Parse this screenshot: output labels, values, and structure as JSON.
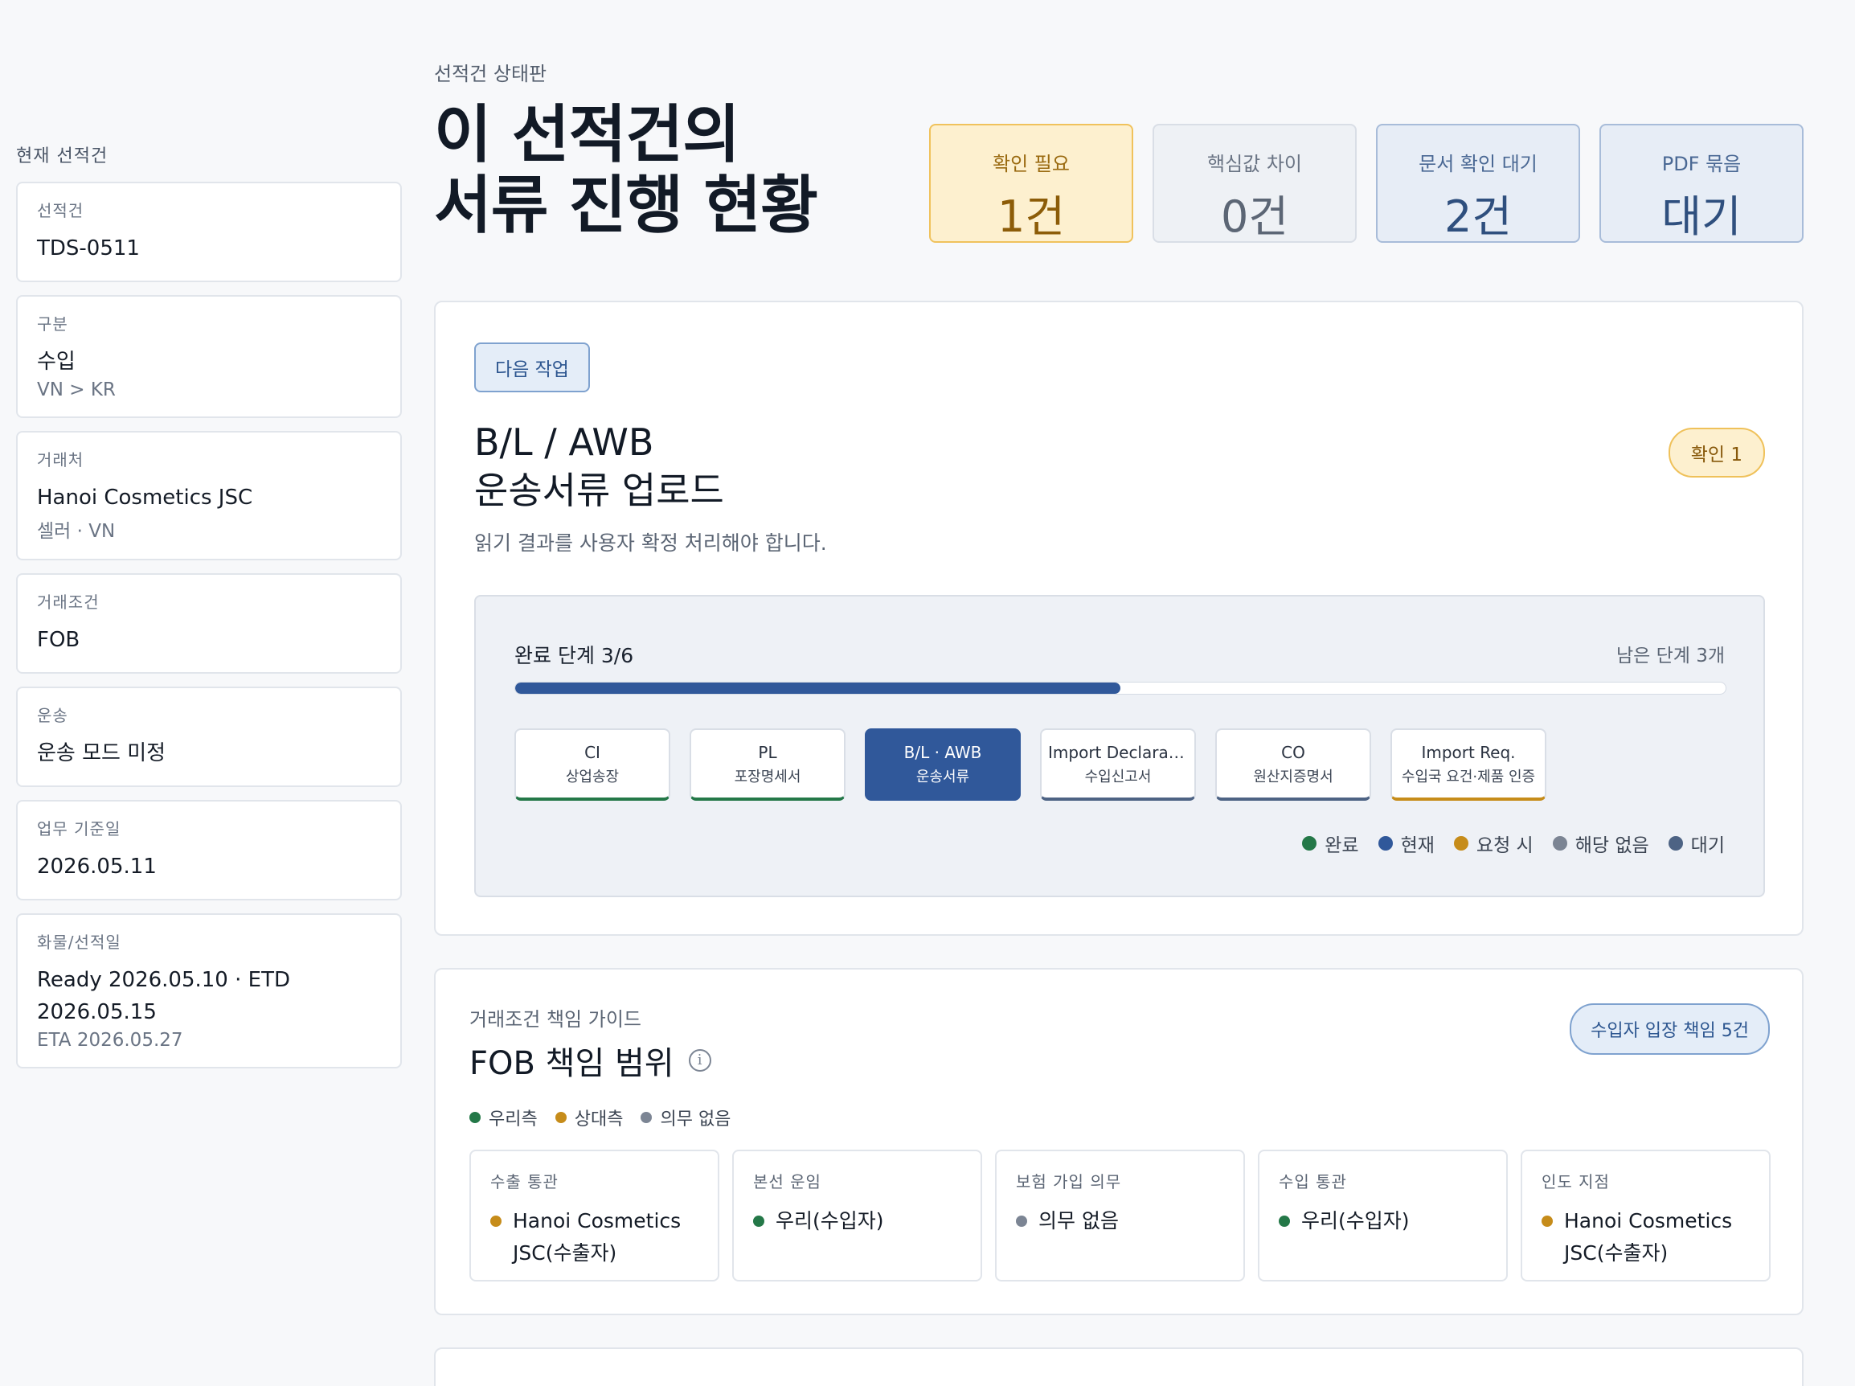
{
  "sidebar": {
    "heading": "현재 선적건",
    "cards": [
      {
        "label": "선적건",
        "value": "TDS-0511",
        "sub": ""
      },
      {
        "label": "구분",
        "value": "수입",
        "sub": "VN > KR"
      },
      {
        "label": "거래처",
        "value": "Hanoi Cosmetics JSC",
        "sub": "셀러 · VN"
      },
      {
        "label": "거래조건",
        "value": "FOB",
        "sub": ""
      },
      {
        "label": "운송",
        "value": "운송 모드 미정",
        "sub": ""
      },
      {
        "label": "업무 기준일",
        "value": "2026.05.11",
        "sub": ""
      },
      {
        "label": "화물/선적일",
        "value": "Ready 2026.05.10 · ETD 2026.05.15",
        "sub": "ETA 2026.05.27"
      }
    ]
  },
  "header": {
    "crumb": "선적건 상태판",
    "title_line1": "이 선적건의",
    "title_line2": "서류 진행 현황"
  },
  "stats": [
    {
      "label": "확인 필요",
      "value": "1건",
      "tone": "warn"
    },
    {
      "label": "핵심값 차이",
      "value": "0건",
      "tone": "neutral"
    },
    {
      "label": "문서 확인 대기",
      "value": "2건",
      "tone": "info"
    },
    {
      "label": "PDF 묶음",
      "value": "대기",
      "tone": "info"
    }
  ],
  "next_task": {
    "tag": "다음 작업",
    "title_line1": "B/L / AWB",
    "title_line2": "운송서류 업로드",
    "badge": "확인 1",
    "description": "읽기 결과를 사용자 확정 처리해야 합니다."
  },
  "progress": {
    "label": "완료 단계 3/6",
    "remaining": "남은 단계 3개",
    "fraction": 0.5,
    "steps": [
      {
        "code": "CI",
        "name": "상업송장",
        "status": "done"
      },
      {
        "code": "PL",
        "name": "포장명세서",
        "status": "done"
      },
      {
        "code": "B/L · AWB",
        "name": "운송서류",
        "status": "current"
      },
      {
        "code": "Import Declaration",
        "name": "수입신고서",
        "status": "waiting"
      },
      {
        "code": "CO",
        "name": "원산지증명서",
        "status": "waiting"
      },
      {
        "code": "Import Req.",
        "name": "수입국 요건·제품 인증",
        "status": "onreq"
      }
    ],
    "legend": [
      {
        "label": "완료",
        "color": "#247848"
      },
      {
        "label": "현재",
        "color": "#30589a"
      },
      {
        "label": "요청 시",
        "color": "#c68c1a"
      },
      {
        "label": "해당 없음",
        "color": "#7c8594"
      },
      {
        "label": "대기",
        "color": "#4d6384"
      }
    ]
  },
  "guide": {
    "crumb": "거래조건 책임 가이드",
    "title": "FOB 책임 범위",
    "badge": "수입자 입장 책임 5건",
    "legend": [
      {
        "label": "우리측",
        "color": "#247848"
      },
      {
        "label": "상대측",
        "color": "#c68c1a"
      },
      {
        "label": "의무 없음",
        "color": "#7c8594"
      }
    ],
    "duties": [
      {
        "label": "수출 통관",
        "value": "Hanoi Cosmetics JSC(수출자)",
        "color": "#c68c1a"
      },
      {
        "label": "본선 운임",
        "value": "우리(수입자)",
        "color": "#247848"
      },
      {
        "label": "보험 가입 의무",
        "value": "의무 없음",
        "color": "#7c8594"
      },
      {
        "label": "수입 통관",
        "value": "우리(수입자)",
        "color": "#247848"
      },
      {
        "label": "인도 지점",
        "value": "Hanoi Cosmetics JSC(수출자)",
        "color": "#c68c1a"
      }
    ]
  }
}
